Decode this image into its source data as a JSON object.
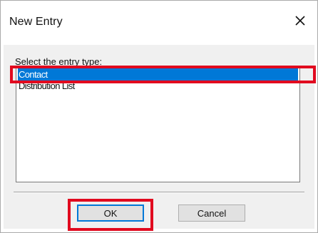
{
  "dialog": {
    "title": "New Entry",
    "close_icon": "close-icon"
  },
  "prompt": "Select the entry type:",
  "entry_types": [
    {
      "label": "Contact",
      "selected": true
    },
    {
      "label": "Distribution List",
      "selected": false
    }
  ],
  "buttons": {
    "ok_label": "OK",
    "cancel_label": "Cancel"
  },
  "colors": {
    "selection": "#0078d7",
    "highlight_frame": "#e10a1f"
  }
}
